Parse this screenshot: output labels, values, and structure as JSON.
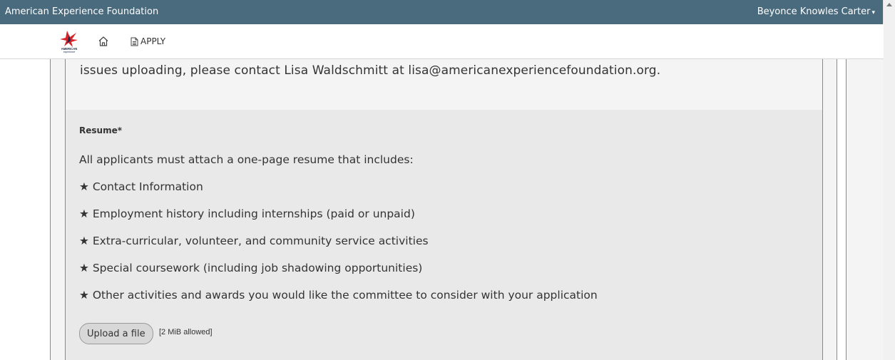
{
  "topbar": {
    "brand": "American Experience Foundation",
    "user": "Beyonce Knowles Carter",
    "user_caret": "▾"
  },
  "nav": {
    "logo_text": "AMERICAN experience",
    "apply_label": "APPLY"
  },
  "intro": {
    "text": "issues uploading, please contact Lisa Waldschmitt at lisa@americanexperiencefoundation.org."
  },
  "resume": {
    "label": "Resume*",
    "description": "All applicants must attach a one-page resume that includes:",
    "items": [
      "★ Contact Information",
      "★ Employment history including internships (paid or unpaid)",
      "★ Extra-curricular, volunteer, and community service activities",
      "★ Special coursework (including job shadowing opportunities)",
      "★ Other activities and awards you would like the committee to consider with your application"
    ],
    "upload_label": "Upload a file",
    "upload_hint": "[2 MiB allowed]"
  },
  "colors": {
    "topbar": "#4a6a7e",
    "logo_red": "#d9252a",
    "logo_navy": "#1b2a4a"
  }
}
